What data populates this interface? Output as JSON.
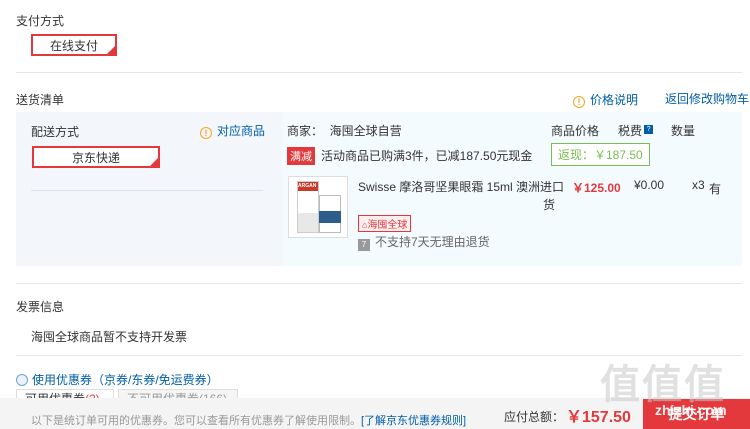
{
  "payment": {
    "title": "支付方式",
    "option": "在线支付"
  },
  "shipping_list": {
    "title": "送货清单",
    "price_note": "价格说明",
    "back_to_cart": "返回修改购物车",
    "method_label": "配送方式",
    "match_products": "对应商品",
    "method_option": "京东快递",
    "merchant": "商家：  海囤全球自营",
    "col_price": "商品价格",
    "col_tax": "税费",
    "col_tax_help": "?",
    "col_qty": "数量",
    "promo_badge": "满减",
    "promo_text": "活动商品已购满3件，已减187.50元现金",
    "cashback": "返现：￥187.50",
    "product": {
      "name": "Swisse 摩洛哥坚果眼霜 15ml 澳洲进口",
      "name_tail": "货",
      "price": "￥125.00",
      "tax": "¥0.00",
      "qty": "x3",
      "stock": "有",
      "sea_tag": "海囤全球",
      "no_return": "不支持7天无理由退货",
      "img_brand": "ARGAN"
    }
  },
  "invoice": {
    "title": "发票信息",
    "note": "海囤全球商品暂不支持开发票"
  },
  "coupon": {
    "label": "使用优惠券（京券/东券/免运费券）",
    "tab_available": "可用优惠券",
    "tab_available_count": "(2)",
    "tab_unavailable": "不可用优惠券(166)",
    "hint": "以下是统订单可用的优惠券。您可以查看所有优惠券了解使用限制。",
    "learn_more": "[了解京东优惠券规则]"
  },
  "footer": {
    "total_label": "应付总额：",
    "total_value": "￥157.50",
    "submit": "提交订单"
  },
  "watermark": {
    "glyphs": "值值值",
    "url": "zhizhi.com"
  },
  "colors": {
    "accent": "#e4393c",
    "link": "#005ea7",
    "warn": "#f5a623",
    "cashback": "#7abd54"
  }
}
